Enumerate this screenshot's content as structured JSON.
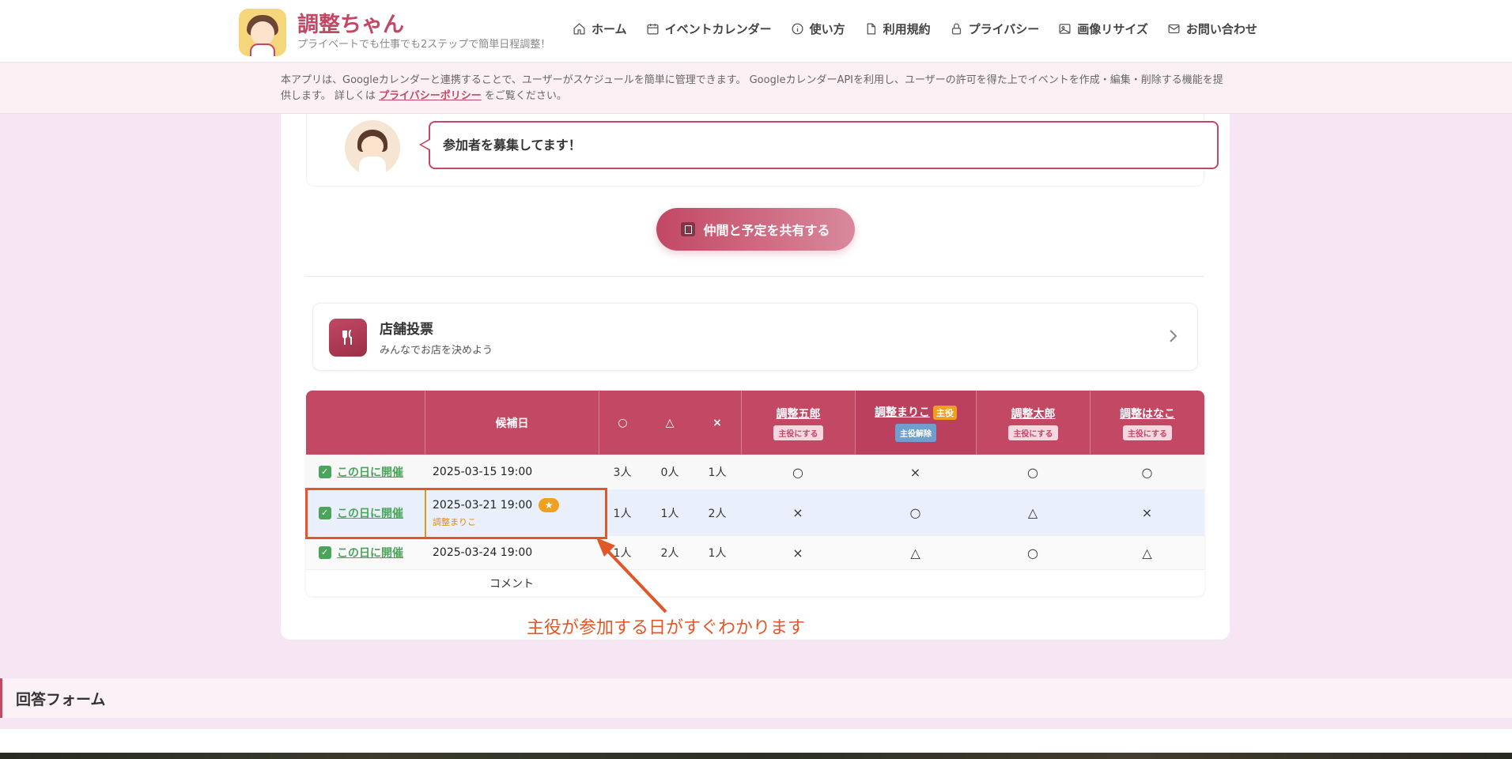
{
  "header": {
    "brand_title": "調整ちゃん",
    "brand_subtitle": "プライベートでも仕事でも2ステップで簡単日程調整！",
    "nav": [
      {
        "label": "ホーム",
        "icon": "home-icon"
      },
      {
        "label": "イベントカレンダー",
        "icon": "calendar-icon"
      },
      {
        "label": "使い方",
        "icon": "info-icon"
      },
      {
        "label": "利用規約",
        "icon": "document-icon"
      },
      {
        "label": "プライバシー",
        "icon": "lock-icon"
      },
      {
        "label": "画像リサイズ",
        "icon": "image-icon"
      },
      {
        "label": "お問い合わせ",
        "icon": "mail-icon"
      }
    ]
  },
  "notice": {
    "text_before": "本アプリは、Googleカレンダーと連携することで、ユーザーがスケジュールを簡単に管理できます。 GoogleカレンダーAPIを利用し、ユーザーの許可を得た上でイベントを作成・編集・削除する機能を提供します。 詳しくは",
    "link": "プライバシーポリシー",
    "text_after": "をご覧ください。"
  },
  "event": {
    "speech": "参加者を募集してます！",
    "share_button": "仲間と予定を共有する"
  },
  "shop_vote": {
    "title": "店舗投票",
    "subtitle": "みんなでお店を決めよう"
  },
  "table": {
    "header": {
      "date": "候補日",
      "ok": "○",
      "maybe": "△",
      "ng": "×"
    },
    "members": [
      {
        "name": "調整五郎",
        "action": "主役にする",
        "lead": false
      },
      {
        "name": "調整まりこ",
        "action": "主役解除",
        "lead": true,
        "lead_label": "主役"
      },
      {
        "name": "調整太郎",
        "action": "主役にする",
        "lead": false
      },
      {
        "name": "調整はなこ",
        "action": "主役にする",
        "lead": false
      }
    ],
    "hold_label": "この日に開催",
    "rows": [
      {
        "date": "2025-03-15 19:00",
        "ok": "3人",
        "maybe": "0人",
        "ng": "1人",
        "answers": [
          "○",
          "×",
          "○",
          "○"
        ],
        "lead_attend": ""
      },
      {
        "date": "2025-03-21 19:00",
        "ok": "1人",
        "maybe": "1人",
        "ng": "2人",
        "answers": [
          "×",
          "○",
          "△",
          "×"
        ],
        "lead_attend": "調整まりこ"
      },
      {
        "date": "2025-03-24 19:00",
        "ok": "1人",
        "maybe": "2人",
        "ng": "1人",
        "answers": [
          "×",
          "△",
          "○",
          "△"
        ],
        "lead_attend": ""
      }
    ],
    "comment_label": "コメント",
    "star": "★"
  },
  "annotation": "主役が参加する日がすぐわかります",
  "answer_form": {
    "title": "回答フォーム"
  },
  "colors": {
    "brand": "#c24864",
    "hold_green": "#4aa55a",
    "lead_orange": "#f0a020",
    "annotation": "#e0572a"
  }
}
